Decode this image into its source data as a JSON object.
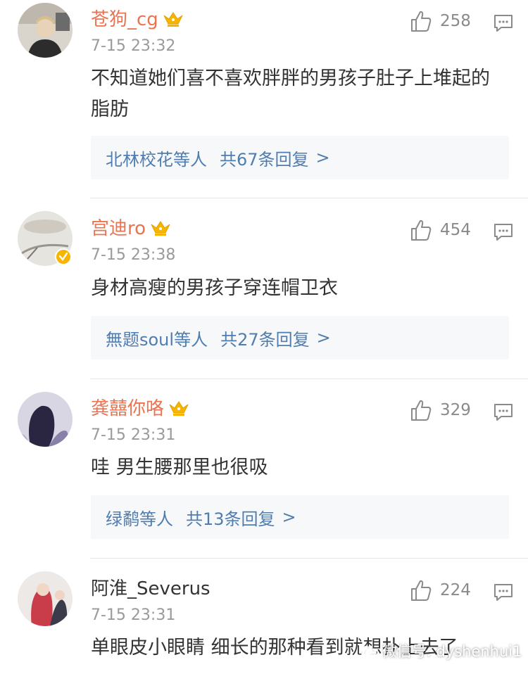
{
  "comments": [
    {
      "username": "苍狗_cg",
      "time": "7-15 23:32",
      "text": "不知道她们喜不喜欢胖胖的男孩子肚子上堆起的脂肪",
      "likes": "258",
      "reply": {
        "who": "北林校花等人",
        "count": "共67条回复",
        "chevron": ">"
      },
      "vip": true,
      "verified": false
    },
    {
      "username": "宫迪ro",
      "time": "7-15 23:38",
      "text": "身材高瘦的男孩子穿连帽卫衣",
      "likes": "454",
      "reply": {
        "who": "無题soul等人",
        "count": "共27条回复",
        "chevron": ">"
      },
      "vip": true,
      "verified": true
    },
    {
      "username": "龚囍你咯",
      "time": "7-15 23:31",
      "text": "哇 男生腰那里也很吸",
      "likes": "329",
      "reply": {
        "who": "绿鹬等人",
        "count": "共13条回复",
        "chevron": ">"
      },
      "vip": true,
      "verified": false
    },
    {
      "username": "阿淮_Severus",
      "time": "7-15 23:31",
      "text": "单眼皮小眼睛 细长的那种看到就想扑上去了",
      "likes": "224",
      "vip": false,
      "verified": false
    }
  ],
  "watermark": "微信号: dyshenhui1",
  "colors": {
    "username": "#eb7350",
    "reply_link": "#507daf",
    "reply_bg": "#f7f8fa",
    "meta": "#9a9a9a",
    "crown": "#f7b500"
  },
  "icons": {
    "like": "thumbs-up-icon",
    "reply": "comment-icon",
    "vip": "crown-icon",
    "verified": "verified-badge-icon"
  }
}
